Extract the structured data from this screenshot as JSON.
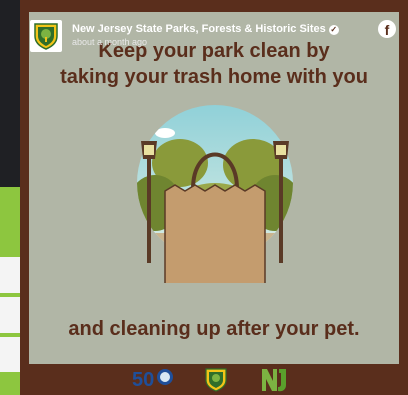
{
  "post": {
    "page_name": "New Jersey State Parks, Forests & Historic Sites",
    "timestamp": "about a month ago",
    "platform_icon": "facebook-icon"
  },
  "graphic": {
    "line1": "Keep your park clean by",
    "line2": "taking your trash home with you",
    "line3": "and cleaning up after your pet.",
    "footer_logos": [
      "50-anniversary-logo",
      "nj-parks-logo",
      "nj-logo"
    ],
    "footer_logo_text": "50"
  },
  "colors": {
    "brand_brown": "#5a2e1c",
    "card_bg": "#b1b6a6",
    "accent_green": "#8dc63f"
  }
}
